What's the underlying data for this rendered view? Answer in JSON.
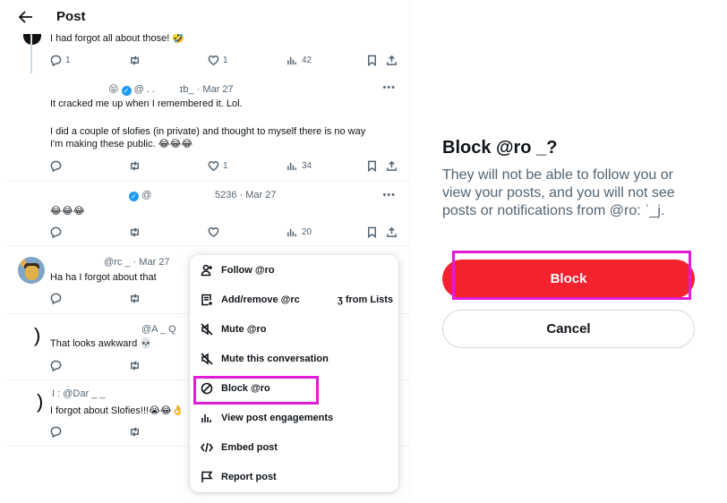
{
  "header": {
    "title": "Post"
  },
  "tweets": [
    {
      "text": "I had forgot all about those! 🤣",
      "replies": "1",
      "likes": "1",
      "views": "42"
    },
    {
      "meta": "😝 ✔ @ . . ɪb_ · Mar 27",
      "handle": "@ . . ɪb_",
      "date": "Mar 27",
      "text_line1": "It cracked me up when I remembered it. Lol.",
      "text_line2": "I did a couple of slofies (in private) and thought to myself there is no way",
      "text_line3": "I'm making these public. 😂😂😂",
      "replies": "",
      "likes": "1",
      "views": "34"
    },
    {
      "handle": "@",
      "meta_right": "5236 · Mar 27",
      "text": "😂😂😂",
      "replies": "",
      "likes": "",
      "views": "20"
    },
    {
      "meta": "@rc        _ · Mar 27",
      "text": "Ha ha I forgot about that"
    },
    {
      "meta": "@A  _   Q",
      "text": "That looks awkward 💀"
    },
    {
      "meta": "I                 : @Dar  _ _",
      "text": "I forgot about Slofies!!!😭😂👌"
    }
  ],
  "menu": {
    "items": [
      {
        "icon": "follow-icon",
        "label": "Follow @ro"
      },
      {
        "icon": "list-add-icon",
        "label": "Add/remove @rc",
        "label_tail": "ʒ from Lists"
      },
      {
        "icon": "mute-icon",
        "label": "Mute @ro"
      },
      {
        "icon": "mute-icon",
        "label": "Mute this conversation"
      },
      {
        "icon": "block-icon",
        "label": "Block @ro"
      },
      {
        "icon": "engagements-icon",
        "label": "View post engagements"
      },
      {
        "icon": "embed-icon",
        "label": "Embed post"
      },
      {
        "icon": "flag-icon",
        "label": "Report post"
      }
    ]
  },
  "dialog": {
    "title": "Block @ro        _?",
    "body": "They will not be able to follow you or view your posts, and you will not see posts or notifications from @ro:       ʾ_j.",
    "block_label": "Block",
    "cancel_label": "Cancel"
  },
  "colors": {
    "block_red": "#f4212e",
    "highlight_magenta": "#e21cd6",
    "verified_blue": "#1d9bf0",
    "muted_gray": "#536471"
  }
}
